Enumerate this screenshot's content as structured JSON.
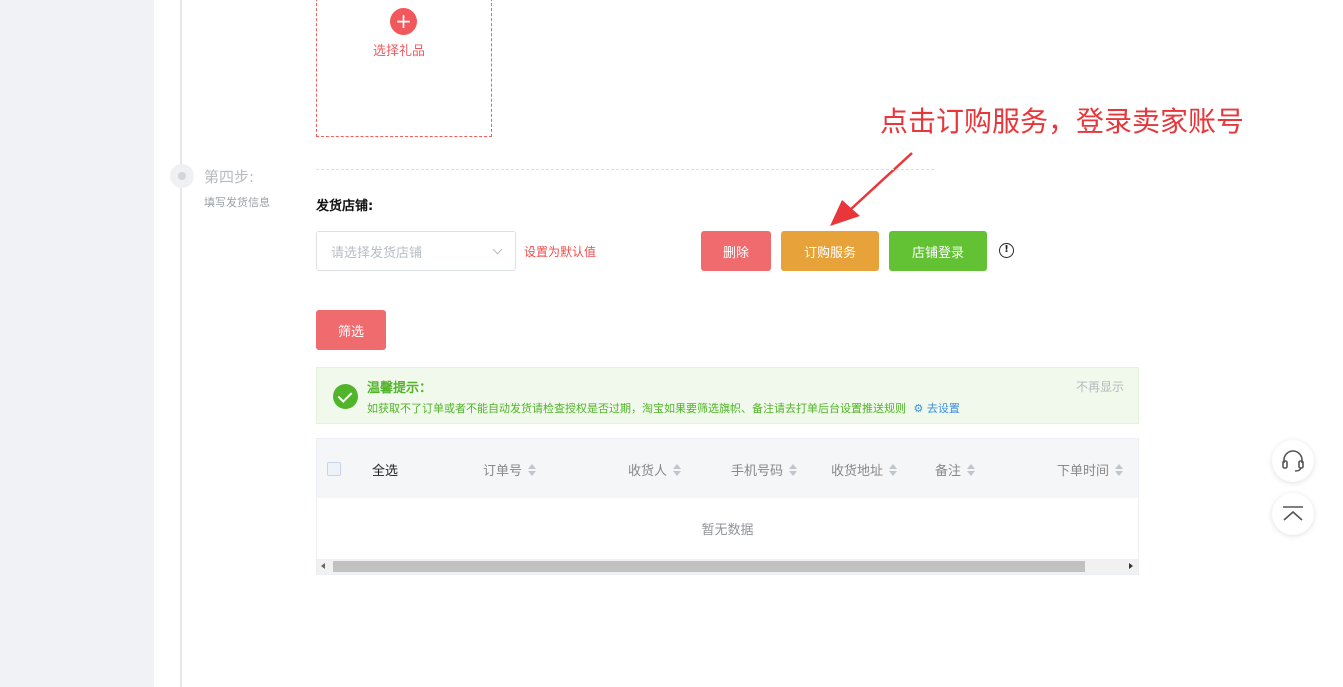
{
  "gift": {
    "add_label": "选择礼品"
  },
  "annotation": {
    "text": "点击订购服务，登录卖家账号"
  },
  "step": {
    "title": "第四步:",
    "subtitle": "填写发货信息"
  },
  "shop": {
    "label": "发货店铺:",
    "select_placeholder": "请选择发货店铺",
    "set_default": "设置为默认值",
    "delete_button": "删除",
    "order_button": "订购服务",
    "login_button": "店铺登录",
    "info_icon": "!"
  },
  "filter_button": "筛选",
  "tip": {
    "title": "温馨提示：",
    "text": "如获取不了订单或者不能自动发货请检查授权是否过期，淘宝如果要筛选旗帜、备注请去打单后台设置推送规则",
    "link": "去设置",
    "dismiss": "不再显示"
  },
  "table": {
    "columns": [
      "全选",
      "订单号",
      "收货人",
      "手机号码",
      "收货地址",
      "备注",
      "下单时间"
    ],
    "empty_text": "暂无数据"
  },
  "colors": {
    "accent_red": "#ef6b6e",
    "order_orange": "#e7a33a",
    "login_green": "#62c234",
    "annotation_red": "#e8363a"
  },
  "icons": [
    "plus-icon",
    "chevron-down-icon",
    "info-icon",
    "check-circle-icon",
    "gear-icon",
    "sort-icon",
    "headset-icon",
    "back-to-top-icon",
    "arrow-annotation"
  ]
}
